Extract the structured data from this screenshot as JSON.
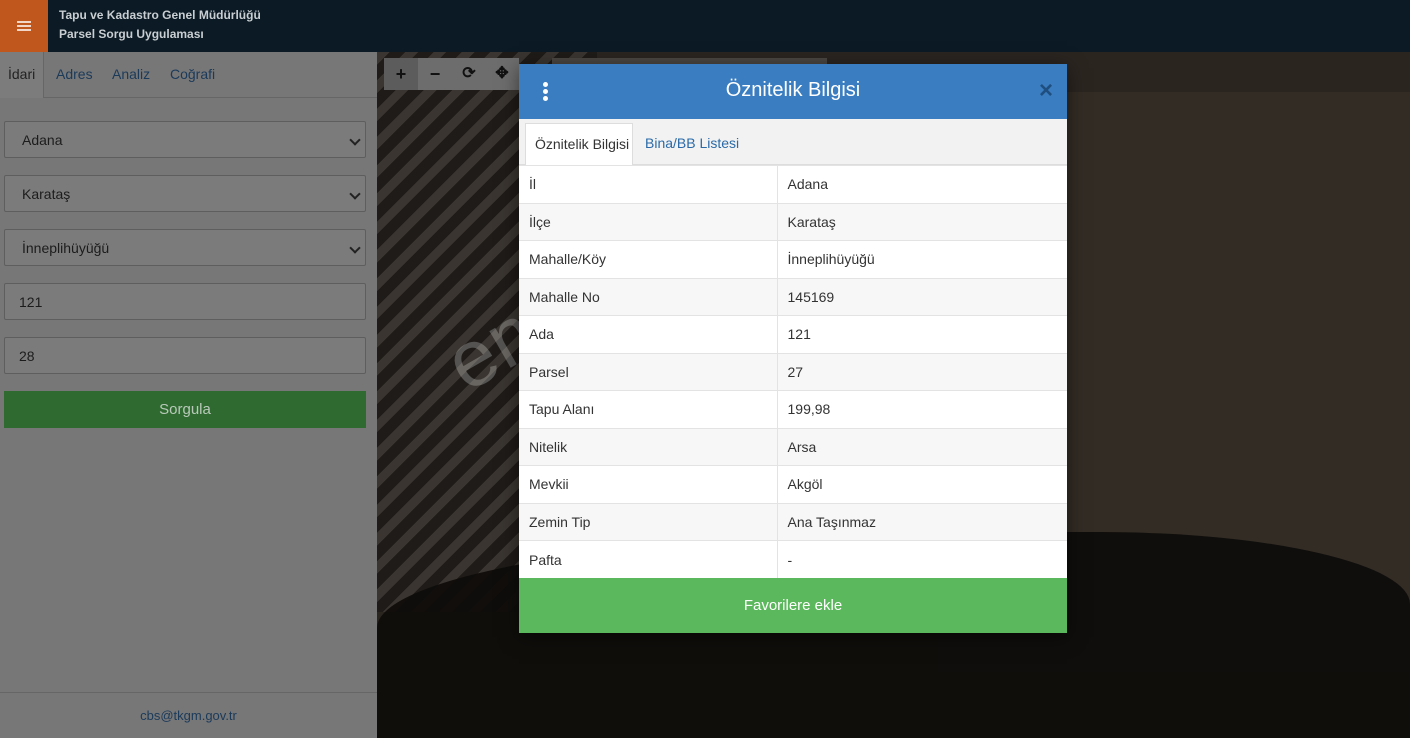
{
  "header": {
    "title_line1": "Tapu ve Kadastro Genel Müdürlüğü",
    "title_line2": "Parsel Sorgu Uygulaması"
  },
  "sidebar": {
    "tabs": [
      {
        "label": "İdari",
        "active": true
      },
      {
        "label": "Adres",
        "active": false
      },
      {
        "label": "Analiz",
        "active": false
      },
      {
        "label": "Coğrafi",
        "active": false
      }
    ],
    "il": "Adana",
    "ilce": "Karataş",
    "mahalle": "İnneplihüyüğü",
    "ada": "121",
    "parsel": "28",
    "query_button": "Sorgula",
    "footer_email": "cbs@tkgm.gov.tr"
  },
  "map": {
    "watermark": "emlakjet.com"
  },
  "modal": {
    "title": "Öznitelik Bilgisi",
    "close": "×",
    "tabs": [
      {
        "label": "Öznitelik Bilgisi",
        "active": true
      },
      {
        "label": "Bina/BB Listesi",
        "active": false
      }
    ],
    "rows": [
      {
        "key": "İl",
        "value": "Adana"
      },
      {
        "key": "İlçe",
        "value": "Karataş"
      },
      {
        "key": "Mahalle/Köy",
        "value": "İnneplihüyüğü"
      },
      {
        "key": "Mahalle No",
        "value": "145169"
      },
      {
        "key": "Ada",
        "value": "121"
      },
      {
        "key": "Parsel",
        "value": "27"
      },
      {
        "key": "Tapu Alanı",
        "value": "199,98"
      },
      {
        "key": "Nitelik",
        "value": "Arsa"
      },
      {
        "key": "Mevkii",
        "value": "Akgöl"
      },
      {
        "key": "Zemin Tip",
        "value": "Ana Taşınmaz"
      },
      {
        "key": "Pafta",
        "value": "-"
      }
    ],
    "footer_button": "Favorilere ekle"
  },
  "colors": {
    "header_bg": "#0b1a24",
    "menu_button": "#c0581e",
    "modal_header": "#3a7dc0",
    "favorite_button": "#5cb85c"
  }
}
